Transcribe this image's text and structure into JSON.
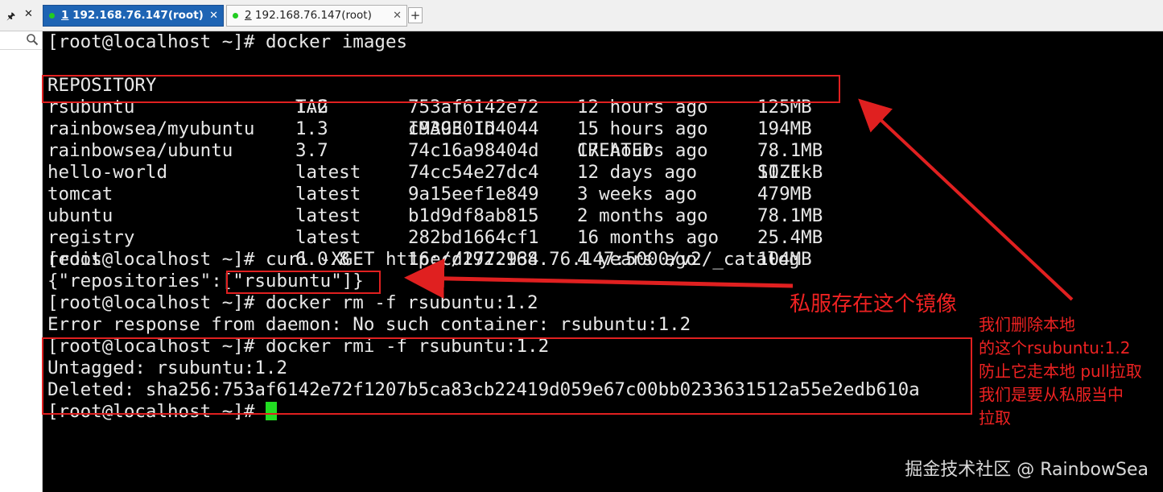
{
  "tabs": [
    {
      "number": "1",
      "title": " 192.168.76.147(root)",
      "active": true
    },
    {
      "number": "2",
      "title": " 192.168.76.147(root)",
      "active": false
    }
  ],
  "add_tab_label": "+",
  "icons": {
    "pin": "pin-icon",
    "close": "close-icon",
    "search": "search-icon",
    "add": "add-tab-icon"
  },
  "colors": {
    "tab_active": "#1e64b4",
    "tab_dot": "#22cc22",
    "annotation": "#e02020",
    "cursor": "#22dd22"
  },
  "terminal": {
    "prompt": "[root@localhost ~]# ",
    "cmd_images": "docker images",
    "columns": [
      "REPOSITORY",
      "TAG",
      "IMAGE ID",
      "CREATED",
      "SIZE"
    ],
    "rows": [
      [
        "rsubuntu",
        "1.2",
        "753af6142e72",
        "12 hours ago",
        "125MB"
      ],
      [
        "rainbowsea/myubuntu",
        "1.3",
        "c939301d4044",
        "15 hours ago",
        "194MB"
      ],
      [
        "rainbowsea/ubuntu",
        "3.7",
        "74c16a98404d",
        "17 hours ago",
        "78.1MB"
      ],
      [
        "hello-world",
        "latest",
        "74cc54e27dc4",
        "12 days ago",
        "10.1kB"
      ],
      [
        "tomcat",
        "latest",
        "9a15eef1e849",
        "3 weeks ago",
        "479MB"
      ],
      [
        "ubuntu",
        "latest",
        "b1d9df8ab815",
        "2 months ago",
        "78.1MB"
      ],
      [
        "registry",
        "latest",
        "282bd1664cf1",
        "16 months ago",
        "25.4MB"
      ],
      [
        "redis",
        "6.0.8",
        "16ecd2772934",
        "4 years ago",
        "104MB"
      ]
    ],
    "cmd_curl": "curl -XGET http://192.168.76.147:5000/v2/_catalog",
    "curl_prefix": "{\"repositories\":",
    "curl_value": "[\"rsubuntu\"]}",
    "cmd_rm": "docker rm -f rsubuntu:1.2",
    "rm_error": "Error response from daemon: No such container: rsubuntu:1.2",
    "cmd_rmi": "docker rmi -f rsubuntu:1.2",
    "untagged": "Untagged: rsubuntu:1.2",
    "deleted": "Deleted: sha256:753af6142e72f1207b5ca83cb22419d059e67c00bb0233631512a55e2edb610a"
  },
  "annotations": {
    "main": "私服存在这个镜像",
    "side": [
      "我们删除本地",
      "的这个rsubuntu:1.2",
      "防止它走本地 pull拉取",
      "我们是要从私服当中",
      "拉取"
    ]
  },
  "watermark": "掘金技术社区 @ RainbowSea"
}
